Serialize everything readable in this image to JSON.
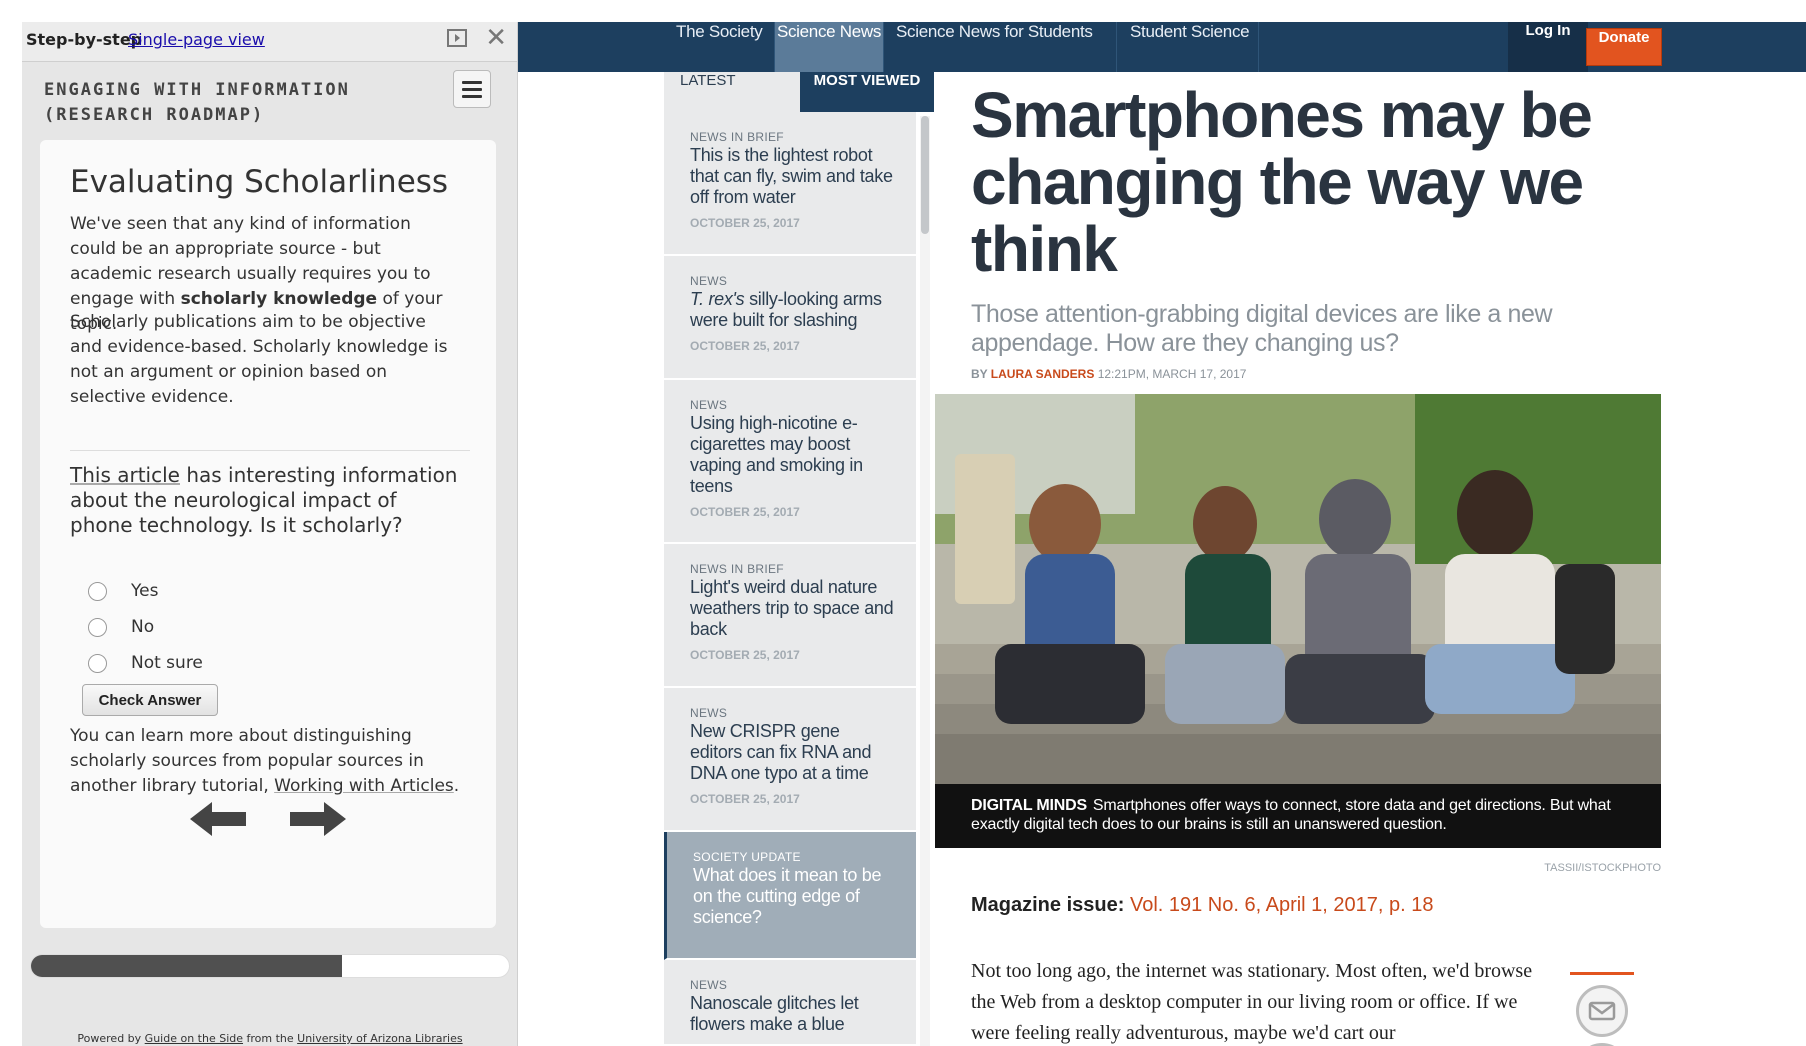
{
  "guide": {
    "mode_label": "Step-by-step",
    "single_page_link": "Single-page view",
    "title_line1": "ENGAGING WITH INFORMATION",
    "title_line2": "(RESEARCH ROADMAP)",
    "card": {
      "heading": "Evaluating Scholarliness",
      "para1_a": "We've seen that any kind of information could be an appropriate source - but academic research usually requires you to engage with ",
      "para1_bold": "scholarly knowledge",
      "para1_b": " of your topic.",
      "para2": "Scholarly publications aim to be objective and evidence-based. Scholarly knowledge is not an argument or opinion based on selective evidence.",
      "question_link": "This article",
      "question_rest": " has interesting information about the neurological impact of phone technology. Is it scholarly?",
      "options": [
        "Yes",
        "No",
        "Not sure"
      ],
      "check_button": "Check Answer",
      "para3_a": "You can learn more about distinguishing scholarly sources from popular sources in another library tutorial, ",
      "para3_link": "Working with Articles",
      "para3_b": "."
    },
    "progress": 0.65,
    "powered_prefix": "Powered by ",
    "powered_link1": "Guide on the Side",
    "powered_mid": " from the ",
    "powered_link2": "University of Arizona Libraries"
  },
  "site": {
    "nav": [
      "The Society",
      "Science News",
      "Science News for Students",
      "Student Science"
    ],
    "active_nav": "Science News",
    "login": "Log In",
    "donate": "Donate",
    "tabs": {
      "latest": "LATEST",
      "most_viewed": "MOST VIEWED"
    },
    "stories": [
      {
        "kicker": "News in Brief",
        "title": "This is the lightest robot that can fly, swim and take off from water",
        "date": "OCTOBER 25, 2017"
      },
      {
        "kicker": "News",
        "title_italic": "T. rex's",
        "title": " silly-looking arms were built for slashing",
        "date": "OCTOBER 25, 2017"
      },
      {
        "kicker": "News",
        "title": "Using high-nicotine e-cigarettes may boost vaping and smoking in teens",
        "date": "OCTOBER 25, 2017"
      },
      {
        "kicker": "News in Brief",
        "title": "Light's weird dual nature weathers trip to space and back",
        "date": "OCTOBER 25, 2017"
      },
      {
        "kicker": "News",
        "title": "New CRISPR gene editors can fix RNA and DNA one typo at a time",
        "date": "OCTOBER 25, 2017"
      },
      {
        "kicker": "Society Update",
        "title": "What does it mean to be on the cutting edge of science?",
        "date": ""
      },
      {
        "kicker": "News",
        "title": "Nanoscale glitches let flowers make a blue",
        "date": ""
      }
    ],
    "article": {
      "headline": "Smartphones may be changing the way we think",
      "dek": "Those attention-grabbing digital devices are like a new appendage. How are they changing us?",
      "by": "BY ",
      "author": "LAURA SANDERS",
      "timestamp": " 12:21PM, MARCH 17, 2017",
      "caption_label": "DIGITAL MINDS",
      "caption": "Smartphones offer ways to connect, store data and get directions. But what exactly digital tech does to our brains is still an unanswered question.",
      "credit": "TASSII/ISTOCKPHOTO",
      "magazine_label": "Magazine issue:",
      "magazine_link": "Vol. 191 No. 6, April 1, 2017, p. 18",
      "body": "Not too long ago, the internet was stationary. Most often, we'd browse the Web from a desktop computer in our living room or office. If we were feeling really adventurous, maybe we'd cart our"
    }
  },
  "colors": {
    "nav_bg": "#1d3f5f",
    "accent_orange": "#e2541f",
    "author_red": "#c84a1b"
  }
}
